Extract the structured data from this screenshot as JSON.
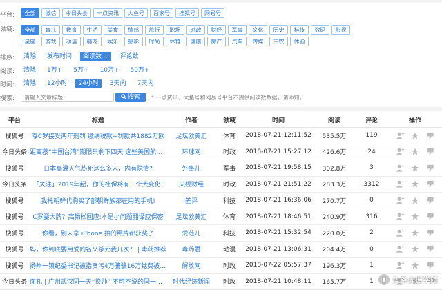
{
  "filters": {
    "platform": {
      "label": "平台:",
      "items": [
        "全部",
        "微信",
        "今日头条",
        "一点资讯",
        "大鱼号",
        "百家号",
        "搜狐号",
        "网易号"
      ],
      "active": 0
    },
    "domain": {
      "label": "领域:",
      "row1": [
        "全部",
        "育儿",
        "教育",
        "生活",
        "美食",
        "情感",
        "旅行",
        "职场",
        "时政",
        "财经",
        "军事",
        "文化",
        "历史",
        "科技",
        "数码",
        "影视"
      ],
      "row2": [
        "星座",
        "游戏",
        "动漫",
        "萌宠",
        "娱乐",
        "摄影",
        "时尚",
        "体育",
        "健康",
        "房产",
        "汽车",
        "传媒",
        "三农",
        "体验"
      ],
      "active": 0
    },
    "sort": {
      "label": "排序:",
      "items": [
        "清除",
        "发布时间",
        "阅读数 ↓",
        "评论数"
      ],
      "active": 2
    },
    "reads": {
      "label": "阅读:",
      "items": [
        "清除",
        "1万+",
        "5万+",
        "10万+",
        "50万+"
      ]
    },
    "time": {
      "label": "时间:",
      "items": [
        "清除",
        "12小时",
        "24小时",
        "3天内",
        "7天内"
      ],
      "active": 2
    },
    "search": {
      "label": "搜索:",
      "placeholder": "请输入文章标题",
      "button": "搜索",
      "note": "* 一点资讯、大鱼号和网易号平台不提供阅读数数据，请添知。"
    }
  },
  "table": {
    "headers": [
      "平台",
      "标题",
      "作者",
      "领域",
      "时间",
      "阅读",
      "评论",
      "操作"
    ],
    "rows": [
      [
        "搜狐号",
        "曝C罗接受两年刑罚 缴纳税款+罚款共1882万欧",
        "足坛欧美汇",
        "体育",
        "2018-07-21 12:11:52",
        "535.5万",
        "119"
      ],
      [
        "今日头条",
        "距离蔡“中国台湾”期限只剩下四天 这些美国航空…",
        "环球网",
        "时政",
        "2018-07-21 15:27:12",
        "426.6万",
        "24"
      ],
      [
        "搜狐号",
        "日本高温天气热死这么多人，内有隐情?",
        "外事儿",
        "军事",
        "2018-07-21 19:58:15",
        "302.8万",
        "3"
      ],
      [
        "今日头条",
        "「关注」2019年起，你的社保将有一个大变化!",
        "央视财经",
        "时政",
        "2018-07-21 21:51:22",
        "283.3万",
        "3312"
      ],
      [
        "搜狐号",
        "我托朝鲜代购买了部朝鲜族都在用的手机!",
        "差评",
        "科技",
        "2018-07-21 16:36:06",
        "270.7万",
        "0"
      ],
      [
        "搜狐号",
        "C罗要大牌？高畅松回应:本是小问题翻译应保密",
        "足坛欧美汇",
        "体育",
        "2018-07-21 18:46:51",
        "240.9万",
        "316"
      ],
      [
        "搜狐号",
        "你看，别人拿 iPhone 拍的照片都获奖了",
        "爱范儿",
        "科技",
        "2018-07-21 15:32:54",
        "220.0万",
        "2"
      ],
      [
        "搜狐号",
        "妈，你到底要用爱的名义杀死我几次？ | 毒药推荐",
        "毒药君",
        "动漫",
        "2018-07-21 13:06:31",
        "204.4万",
        "0"
      ],
      [
        "搜狐号",
        "扬州一镇纪委书记被指贪污4万骗骗16万党费被人…",
        "解放网",
        "时政",
        "2018-07-22 05:57:37",
        "196.3万",
        "1"
      ],
      [
        "今日头条",
        "面孔 | 广州武汉同一天“换帅” 不可不说的同一个…",
        "时代经济新闻",
        "时政",
        "2018-07-21 10:48:11",
        "165.7万",
        "1"
      ]
    ]
  },
  "watermark": "头条@搜学院",
  "colors": {
    "accent": "#3b87e6",
    "link": "#2e7cd6"
  }
}
